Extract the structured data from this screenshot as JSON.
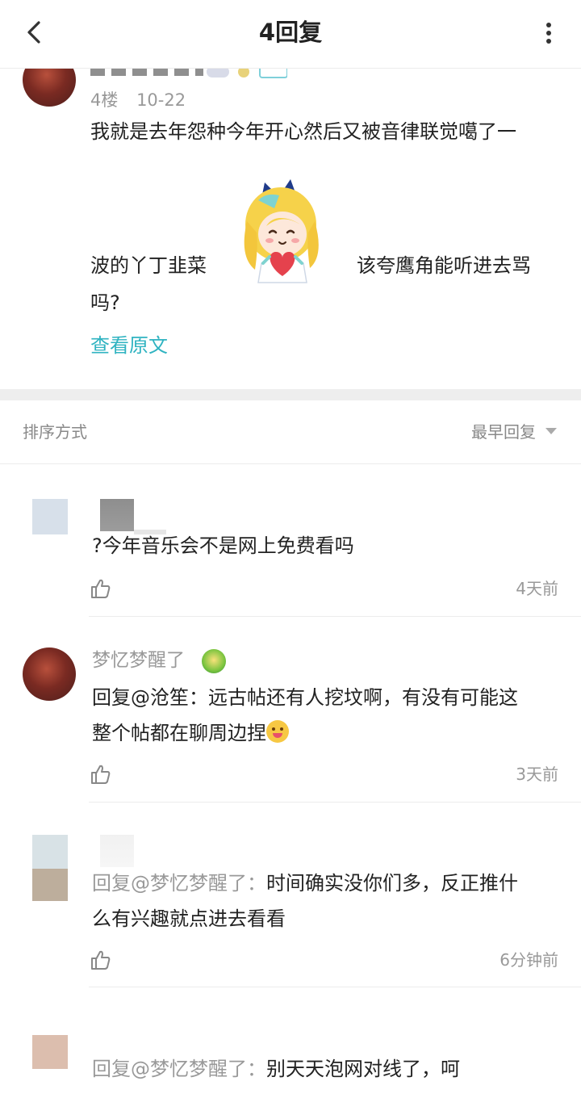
{
  "header": {
    "title": "4回复",
    "back_icon": "chevron-left-icon",
    "more_icon": "more-vertical-icon"
  },
  "post": {
    "floor": "4楼",
    "date": "10-22",
    "text_line1": "我就是去年怨种今年开心然后又被音律联觉噶了一",
    "text_line2_a": "波的丫丁韭菜",
    "text_line2_b": "该夸鹰角能听进去骂",
    "text_line3": "吗?",
    "sticker_icon": "anime-girl-heart-sticker-icon",
    "view_original": "查看原文"
  },
  "sort": {
    "label": "排序方式",
    "value": "最早回复"
  },
  "replies": [
    {
      "name": "",
      "text": "?今年音乐会不是网上免费看吗",
      "time": "4天前"
    },
    {
      "name": "梦忆梦醒了",
      "reply_prefix": "回复@沧笙：",
      "text_line1": "远古帖还有人挖坟啊，有没有可能这",
      "text_line2": "整个帖都在聊周边捏",
      "time": "3天前"
    },
    {
      "name": "",
      "reply_prefix": "回复@梦忆梦醒了：",
      "text_line1": "时间确实没你们多，反正推什",
      "text_line2": "么有兴趣就点进去看看",
      "time": "6分钟前"
    },
    {
      "name": "",
      "reply_prefix": "回复@梦忆梦醒了：",
      "text_line1": "别天天泡网对线了，呵"
    }
  ],
  "colors": {
    "accent": "#2fb3c1",
    "muted_text": "#999999",
    "body_text": "#222222",
    "divider": "#eeeeee"
  }
}
